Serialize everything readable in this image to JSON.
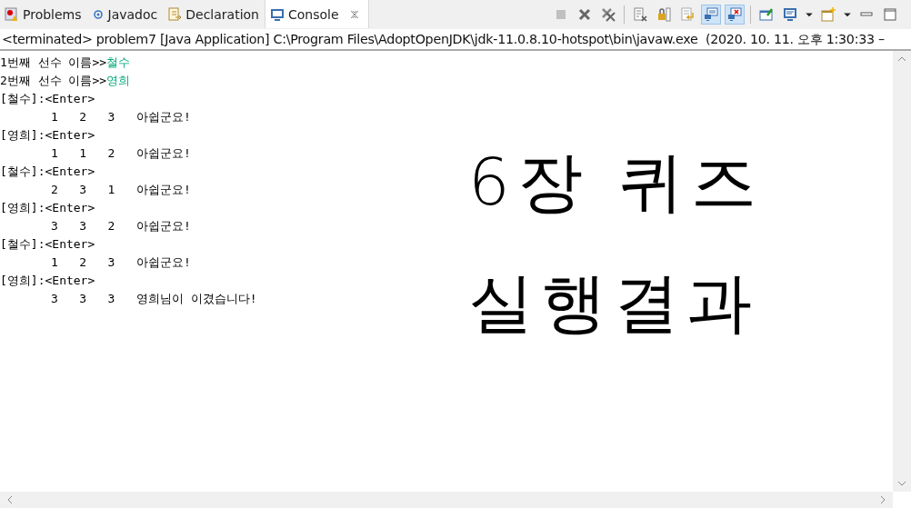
{
  "tabs": [
    {
      "label": "Problems",
      "selected": false
    },
    {
      "label": "Javadoc",
      "selected": false
    },
    {
      "label": "Declaration",
      "selected": false
    },
    {
      "label": "Console",
      "selected": true
    }
  ],
  "toolbar": [
    {
      "kind": "stop",
      "disabled": true,
      "selected": false
    },
    {
      "kind": "remove",
      "disabled": false,
      "selected": false
    },
    {
      "kind": "remove-all",
      "disabled": false,
      "selected": false
    },
    {
      "kind": "sep"
    },
    {
      "kind": "clear",
      "disabled": false,
      "selected": false
    },
    {
      "kind": "lock",
      "disabled": false,
      "selected": false
    },
    {
      "kind": "wrap",
      "disabled": false,
      "selected": false
    },
    {
      "kind": "stdout",
      "disabled": false,
      "selected": true
    },
    {
      "kind": "stderr",
      "disabled": false,
      "selected": true
    },
    {
      "kind": "sep"
    },
    {
      "kind": "pin",
      "disabled": false,
      "selected": false
    },
    {
      "kind": "display",
      "disabled": false,
      "selected": false
    },
    {
      "kind": "caret",
      "disabled": false,
      "selected": false
    },
    {
      "kind": "new",
      "disabled": false,
      "selected": false
    },
    {
      "kind": "caret",
      "disabled": false,
      "selected": false
    },
    {
      "kind": "minimize",
      "disabled": false,
      "selected": false
    },
    {
      "kind": "maximize",
      "disabled": false,
      "selected": false
    }
  ],
  "console": {
    "header": "<terminated> problem7 [Java Application] C:\\Program Files\\AdoptOpenJDK\\jdk-11.0.8.10-hotspot\\bin\\javaw.exe  (2020. 10. 11. 오후 1:30:33 –",
    "lines": [
      {
        "kind": "prompt",
        "text": "1번째 선수 이름>>",
        "input": "철수"
      },
      {
        "kind": "prompt",
        "text": "2번째 선수 이름>>",
        "input": "영희"
      },
      {
        "kind": "turn",
        "text": "[철수]:<Enter>"
      },
      {
        "kind": "result",
        "text": "1   2   3   아쉽군요!"
      },
      {
        "kind": "turn",
        "text": "[영희]:<Enter>"
      },
      {
        "kind": "result",
        "text": "1   1   2   아쉽군요!"
      },
      {
        "kind": "turn",
        "text": "[철수]:<Enter>"
      },
      {
        "kind": "result",
        "text": "2   3   1   아쉽군요!"
      },
      {
        "kind": "turn",
        "text": "[영희]:<Enter>"
      },
      {
        "kind": "result",
        "text": "3   3   2   아쉽군요!"
      },
      {
        "kind": "turn",
        "text": "[철수]:<Enter>"
      },
      {
        "kind": "result",
        "text": "1   2   3   아쉽군요!"
      },
      {
        "kind": "turn",
        "text": "[영희]:<Enter>"
      },
      {
        "kind": "result",
        "text": "3   3   3   영희님이 이겼습니다!"
      }
    ]
  },
  "annotation": [
    "6장 퀴즈",
    "실행결과"
  ]
}
